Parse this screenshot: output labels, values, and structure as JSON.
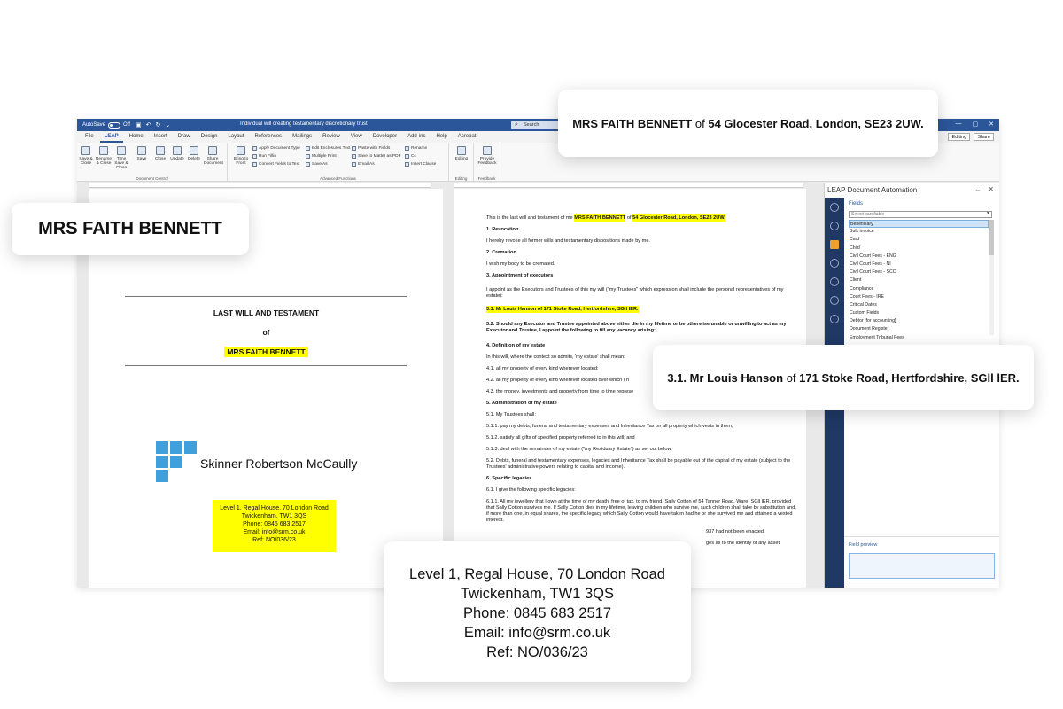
{
  "window": {
    "autosave_label": "AutoSave",
    "autosave_state": "Off",
    "doc_title": "Individual will creating testamentary discretionary trust",
    "search_placeholder": "Search"
  },
  "menu": {
    "tabs": [
      "File",
      "LEAP",
      "Home",
      "Insert",
      "Draw",
      "Design",
      "Layout",
      "References",
      "Mailings",
      "Review",
      "View",
      "Developer",
      "Add-ins",
      "Help",
      "Acrobat"
    ],
    "active_tab": "LEAP",
    "editing": "Editing",
    "share": "Share"
  },
  "ribbon": {
    "doc_control": {
      "label": "Document Control",
      "buttons": [
        "Save & Close",
        "Rename & Close",
        "Time Save & Close",
        "Save",
        "Close",
        "Update",
        "Delete",
        "Share Document"
      ]
    },
    "advanced": {
      "label": "Advanced Functions",
      "bring": "Bring to Front",
      "small": [
        "Apply Document Type",
        "Run Fillin",
        "Convert Fields to Text",
        "Edit Enclosures Text",
        "Multiple Print",
        "Save As",
        "Paste with Fields",
        "Save to Matter as PDF",
        "Email As",
        "Rename",
        "Cc",
        "Insert Clause"
      ]
    },
    "editing": {
      "label": "Editing",
      "button": "Editing"
    },
    "feedback": {
      "label": "Feedback",
      "button": "Provide Feedback"
    }
  },
  "left_page": {
    "title": "LAST WILL AND TESTAMENT",
    "of": "of",
    "name": "MRS FAITH BENNETT",
    "firm": "Skinner Robertson McCaully",
    "address": [
      "Level 1, Regal House, 70 London Road",
      "Twickenham, TW1 3QS",
      "Phone: 0845 683 2517",
      "Email: info@srm.co.uk",
      "Ref: NO/036/23"
    ]
  },
  "right_page": {
    "intro_pre": "This is the last will and testament of me",
    "intro_name": "MRS FAITH BENNETT",
    "intro_of": "of",
    "intro_addr": "54 Glocester Road, London, SE23 2UW.",
    "s1_head": "1.  Revocation",
    "s1_text": "I hereby revoke all former wills and testamentary dispositions made by me.",
    "s2_head": "2. Cremation",
    "s2_text": "I wish my body to be cremated.",
    "s3_head": "3. Appointment of executors",
    "s3_text": "I appoint as the Executors and Trustees of this my will (\"my Trustees\" which expression shall include the personal representatives of my estate):",
    "s31": "3.1. Mr Louis Hanson of 171 Stoke Road, Hertfordshire, SGll lER.",
    "s32": "3.2. Should any Executor and Trustee appointed above either die in my lifetime or be otherwise unable or unwilling  to act as my Executor and Trustee, I appoint the following to fill any vacancy arising:",
    "s4_head": "4. Definition of my estate",
    "s4_text": "In this will, where the context so admits, 'my estate' shall mean:",
    "s41": "4.1. all my property of every kind wherever located;",
    "s42": "4.2. all my property of every kind wherever located over which I h",
    "s43": "4.3. the money, investments and property from time to time represe",
    "s5_head": "5. Administration of my estate",
    "s51": "5.1. My Trustees shall:",
    "s511": "5.1.1. pay my debts, funeral and testamentary expenses and Inheritance Tax on all property which vests in them;",
    "s512": "5.1.2. satisfy all gifts of specified property referred to in this will; and",
    "s513": "5.1.3. deal with the remainder of my estate (\"my Residuary Estate\") as set out below.",
    "s52": "5.2. Debts, funeral and testamentary expenses, legacies and Inheritance Tax shall be payable out of the capital of my estate (subject to the Trustees' administrative powers relating to capital and income).",
    "s6_head": "6. Specific legacies",
    "s61": "6.1. I give the following specific legacies:",
    "s611": "6.1.1. All my jewellery that I own at the time of my death, free of tax, to my friend, Sally Cotton of 54 Tanner Road, Ware, SGll lER, provided that Sally Cotton survives me. If Sally Cotton dies in my lifetime, leaving children who survive me, such children shall take by substitution and, if more than one, in equal shares, the specific legacy which Sally Cotton would have taken had he or she survived me and attained a vested interest.",
    "tail1": "937 had not been enacted.",
    "tail2": "ges as to the identity of any asset"
  },
  "panel": {
    "title": "LEAP Document Automation",
    "fields_label": "Fields",
    "select_placeholder": "Select card/table",
    "fields": [
      "Beneficiary",
      "Bulk invoice",
      "Card",
      "Child",
      "Civil Court Fees - ENG",
      "Civil Court Fees - NI",
      "Civil Court Fees - SCO",
      "Client",
      "Compliance",
      "Court Fees - IRE",
      "Critical Dates",
      "Custom Fields",
      "Debtor [for accounting]",
      "Document Register",
      "Employment Tribunal Fees"
    ],
    "selected_field": "Beneficiary",
    "preview_label": "Field preview"
  },
  "cards": {
    "name": "MRS FAITH BENNETT",
    "testator_name": "MRS FAITH BENNETT",
    "testator_of": "of",
    "testator_addr": "54 Glocester Road, London, SE23 2UW.",
    "executor_name": "3.1. Mr Louis Hanson",
    "executor_of": "of",
    "executor_addr": "171 Stoke Road, Hertfordshire, SGll lER.",
    "address": [
      "Level 1, Regal House, 70 London Road",
      "Twickenham, TW1 3QS",
      "Phone: 0845 683 2517",
      "Email: info@srm.co.uk",
      "Ref: NO/036/23"
    ]
  },
  "colors": {
    "word_blue": "#2b579a",
    "highlight": "#ffff00",
    "panel_rail": "#1f3864",
    "logo": "#3fa0dc"
  }
}
